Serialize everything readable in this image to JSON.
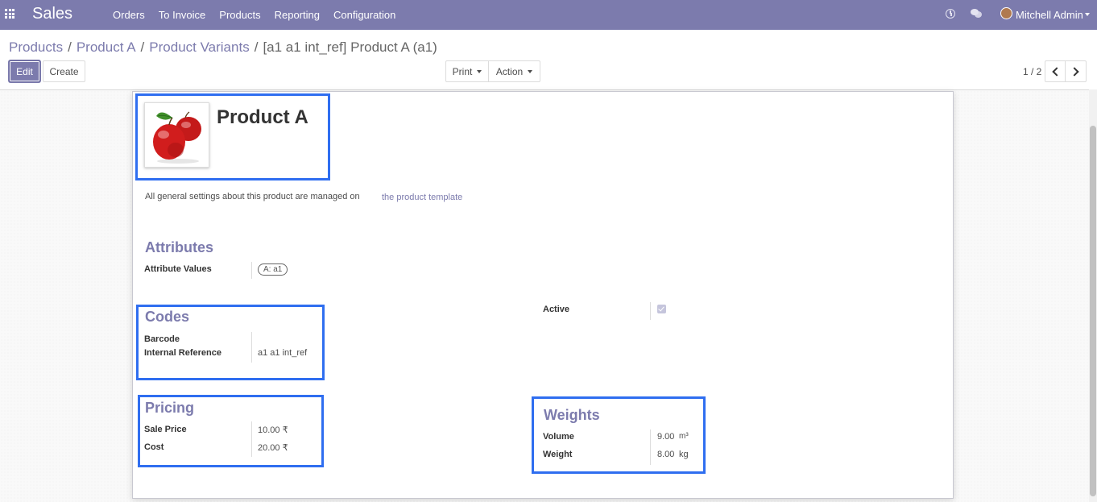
{
  "navbar": {
    "app_name": "Sales",
    "menu": [
      "Orders",
      "To Invoice",
      "Products",
      "Reporting",
      "Configuration"
    ],
    "user_name": "Mitchell Admin"
  },
  "breadcrumb": {
    "items": [
      "Products",
      "Product A",
      "Product Variants"
    ],
    "current": "[a1 a1 int_ref] Product A (a1)",
    "separator": "/"
  },
  "toolbar": {
    "edit_label": "Edit",
    "create_label": "Create",
    "print_label": "Print",
    "action_label": "Action"
  },
  "pager": {
    "value": "1 / 2"
  },
  "product": {
    "name": "Product A",
    "image_icon": "apple-product-image",
    "template_text": "All general settings about this product are managed on",
    "template_link": "the product template"
  },
  "attributes": {
    "title": "Attributes",
    "values_label": "Attribute Values",
    "tags": [
      "A: a1"
    ]
  },
  "codes": {
    "title": "Codes",
    "barcode_label": "Barcode",
    "barcode_value": "",
    "internal_ref_label": "Internal Reference",
    "internal_ref_value": "a1 a1 int_ref"
  },
  "active": {
    "label": "Active",
    "checked": true
  },
  "pricing": {
    "title": "Pricing",
    "sale_price_label": "Sale Price",
    "sale_price_value": "10.00 ₹",
    "cost_label": "Cost",
    "cost_value": "20.00 ₹"
  },
  "weights": {
    "title": "Weights",
    "volume_label": "Volume",
    "volume_value": "9.00",
    "volume_unit": "m³",
    "weight_label": "Weight",
    "weight_value": "8.00",
    "weight_unit": "kg"
  },
  "colors": {
    "brand": "#7c7bad",
    "highlight": "#2f6ef0"
  }
}
